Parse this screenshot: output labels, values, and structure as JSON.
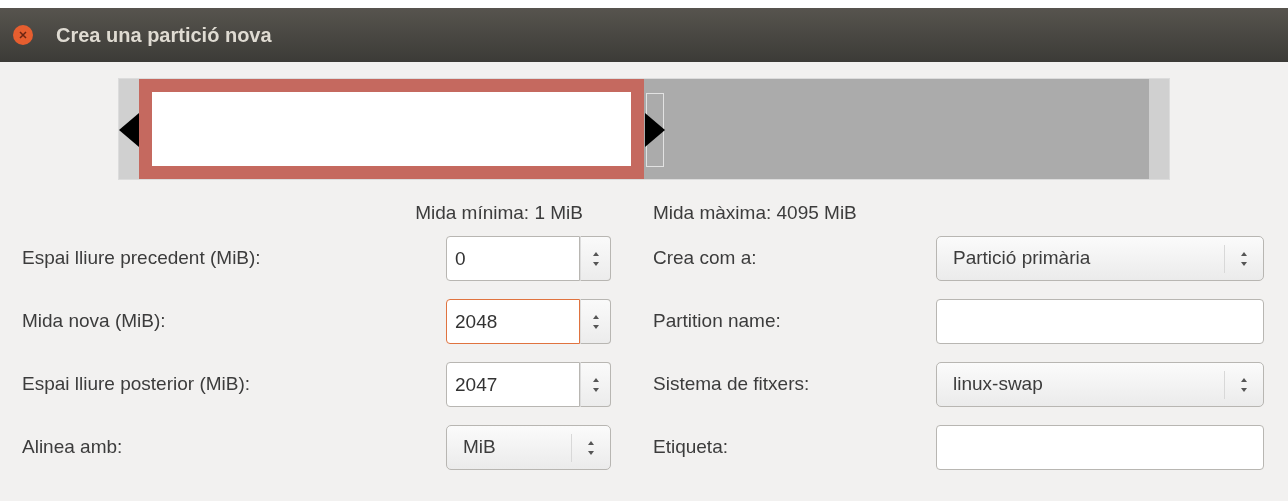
{
  "window": {
    "title": "Crea una partició nova"
  },
  "partition_bar": {
    "level": 0.5
  },
  "limits": {
    "min": "Mida mínima: 1 MiB",
    "max": "Mida màxima: 4095 MiB"
  },
  "left_fields": [
    {
      "label": "Espai lliure precedent (MiB):",
      "kind": "spin",
      "value": "0",
      "focused": false
    },
    {
      "label": "Mida nova (MiB):",
      "kind": "spin",
      "value": "2048",
      "focused": true
    },
    {
      "label": "Espai lliure posterior (MiB):",
      "kind": "spin",
      "value": "2047",
      "focused": false
    },
    {
      "label": "Alinea amb:",
      "kind": "select",
      "value": "MiB",
      "focused": false
    }
  ],
  "right_fields": [
    {
      "label": "Crea com a:",
      "kind": "select",
      "value": "Partició primària",
      "focused": false
    },
    {
      "label": "Partition name:",
      "kind": "text",
      "focused": false
    },
    {
      "label": "Sistema de fitxers:",
      "kind": "select",
      "value": "linux-swap",
      "focused": false
    },
    {
      "label": "Etiqueta:",
      "kind": "text",
      "focused": false
    }
  ]
}
